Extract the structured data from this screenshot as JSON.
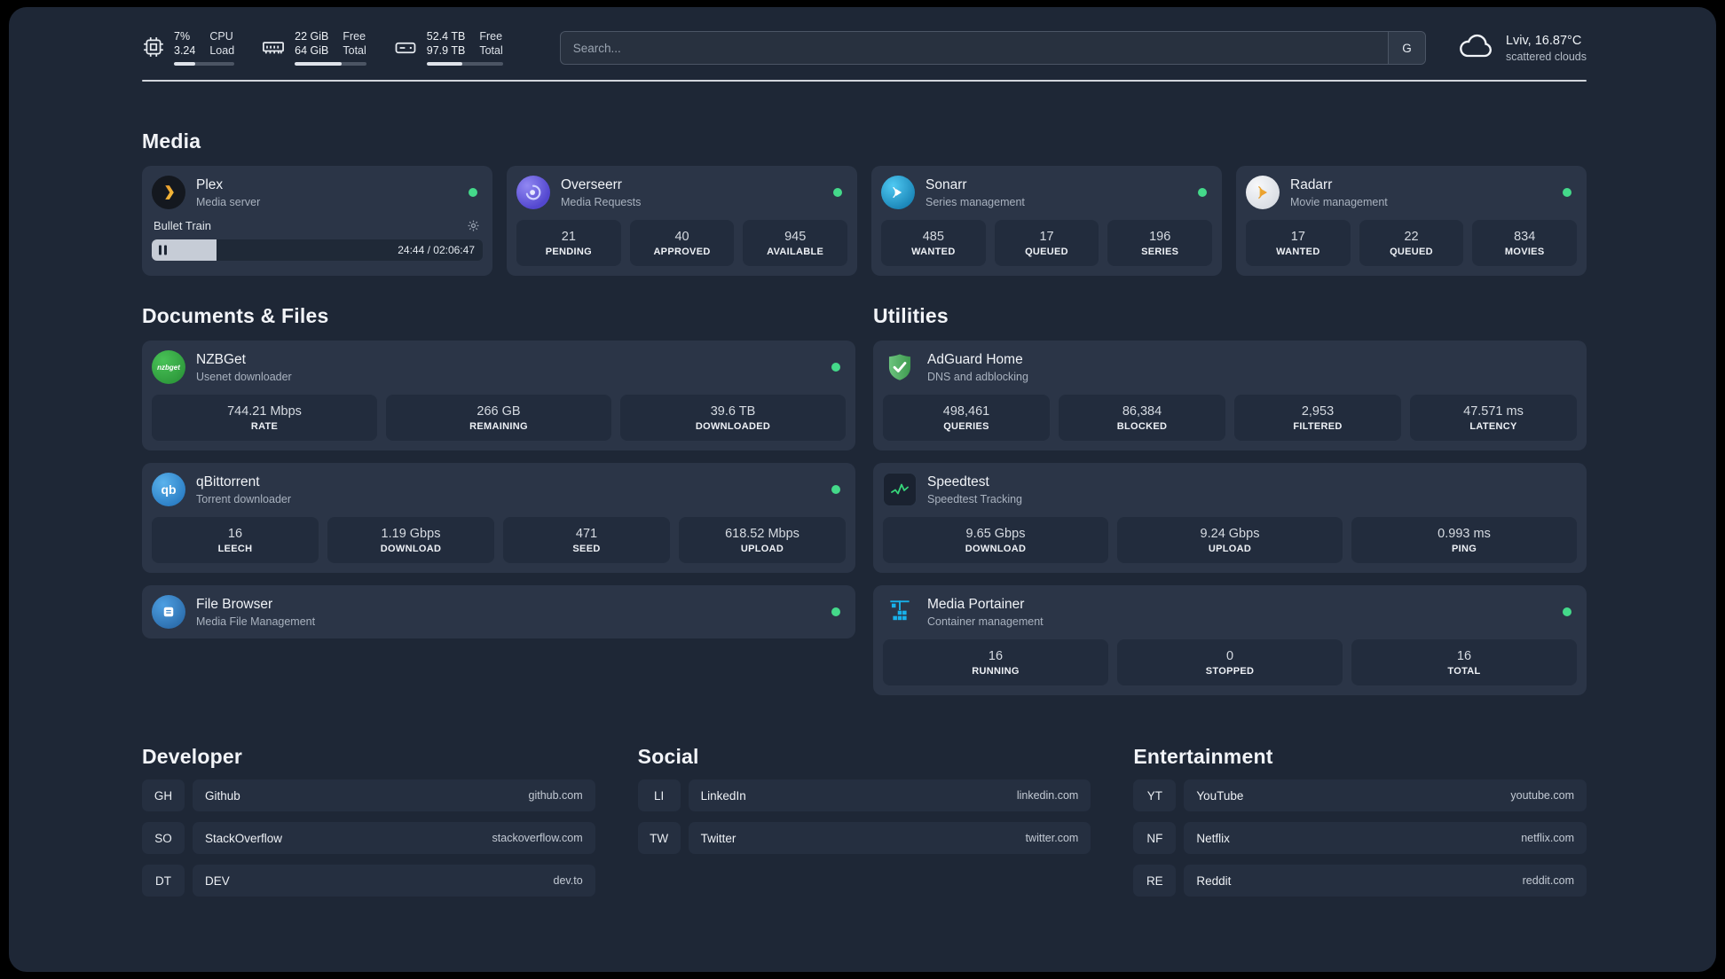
{
  "topbar": {
    "cpu": {
      "value_top": "7%",
      "value_bottom": "3.24",
      "label_top": "CPU",
      "label_bottom": "Load",
      "progress_pct": 35
    },
    "memory": {
      "value_top": "22 GiB",
      "value_bottom": "64 GiB",
      "label_top": "Free",
      "label_bottom": "Total",
      "progress_pct": 66
    },
    "disk": {
      "value_top": "52.4 TB",
      "value_bottom": "97.9 TB",
      "label_top": "Free",
      "label_bottom": "Total",
      "progress_pct": 47
    },
    "search": {
      "placeholder": "Search...",
      "engine_label": "G"
    },
    "weather": {
      "location": "Lviv, 16.87°C",
      "condition": "scattered clouds"
    }
  },
  "media": {
    "heading": "Media",
    "plex": {
      "name": "Plex",
      "subtitle": "Media server",
      "now_playing": "Bullet Train",
      "time_display": "24:44 / 02:06:47",
      "progress_pct": 19.5
    },
    "overseerr": {
      "name": "Overseerr",
      "subtitle": "Media Requests",
      "stats": [
        {
          "value": "21",
          "label": "PENDING"
        },
        {
          "value": "40",
          "label": "APPROVED"
        },
        {
          "value": "945",
          "label": "AVAILABLE"
        }
      ]
    },
    "sonarr": {
      "name": "Sonarr",
      "subtitle": "Series management",
      "stats": [
        {
          "value": "485",
          "label": "WANTED"
        },
        {
          "value": "17",
          "label": "QUEUED"
        },
        {
          "value": "196",
          "label": "SERIES"
        }
      ]
    },
    "radarr": {
      "name": "Radarr",
      "subtitle": "Movie management",
      "stats": [
        {
          "value": "17",
          "label": "WANTED"
        },
        {
          "value": "22",
          "label": "QUEUED"
        },
        {
          "value": "834",
          "label": "MOVIES"
        }
      ]
    }
  },
  "documents": {
    "heading": "Documents & Files",
    "nzbget": {
      "name": "NZBGet",
      "subtitle": "Usenet downloader",
      "stats": [
        {
          "value": "744.21 Mbps",
          "label": "RATE"
        },
        {
          "value": "266 GB",
          "label": "REMAINING"
        },
        {
          "value": "39.6 TB",
          "label": "DOWNLOADED"
        }
      ]
    },
    "qbittorrent": {
      "name": "qBittorrent",
      "subtitle": "Torrent downloader",
      "stats": [
        {
          "value": "16",
          "label": "LEECH"
        },
        {
          "value": "1.19 Gbps",
          "label": "DOWNLOAD"
        },
        {
          "value": "471",
          "label": "SEED"
        },
        {
          "value": "618.52 Mbps",
          "label": "UPLOAD"
        }
      ]
    },
    "filebrowser": {
      "name": "File Browser",
      "subtitle": "Media File Management"
    }
  },
  "utilities": {
    "heading": "Utilities",
    "adguard": {
      "name": "AdGuard Home",
      "subtitle": "DNS and adblocking",
      "stats": [
        {
          "value": "498,461",
          "label": "QUERIES"
        },
        {
          "value": "86,384",
          "label": "BLOCKED"
        },
        {
          "value": "2,953",
          "label": "FILTERED"
        },
        {
          "value": "47.571 ms",
          "label": "LATENCY"
        }
      ]
    },
    "speedtest": {
      "name": "Speedtest",
      "subtitle": "Speedtest Tracking",
      "stats": [
        {
          "value": "9.65 Gbps",
          "label": "DOWNLOAD"
        },
        {
          "value": "9.24 Gbps",
          "label": "UPLOAD"
        },
        {
          "value": "0.993 ms",
          "label": "PING"
        }
      ]
    },
    "portainer": {
      "name": "Media Portainer",
      "subtitle": "Container management",
      "stats": [
        {
          "value": "16",
          "label": "RUNNING"
        },
        {
          "value": "0",
          "label": "STOPPED"
        },
        {
          "value": "16",
          "label": "TOTAL"
        }
      ]
    }
  },
  "linkgroups": [
    {
      "heading": "Developer",
      "items": [
        {
          "abbr": "GH",
          "name": "Github",
          "url": "github.com"
        },
        {
          "abbr": "SO",
          "name": "StackOverflow",
          "url": "stackoverflow.com"
        },
        {
          "abbr": "DT",
          "name": "DEV",
          "url": "dev.to"
        }
      ]
    },
    {
      "heading": "Social",
      "items": [
        {
          "abbr": "LI",
          "name": "LinkedIn",
          "url": "linkedin.com"
        },
        {
          "abbr": "TW",
          "name": "Twitter",
          "url": "twitter.com"
        }
      ]
    },
    {
      "heading": "Entertainment",
      "items": [
        {
          "abbr": "YT",
          "name": "YouTube",
          "url": "youtube.com"
        },
        {
          "abbr": "NF",
          "name": "Netflix",
          "url": "netflix.com"
        },
        {
          "abbr": "RE",
          "name": "Reddit",
          "url": "reddit.com"
        }
      ]
    }
  ],
  "colors": {
    "status_online": "#44d98a",
    "accent_green": "#37d67a"
  }
}
